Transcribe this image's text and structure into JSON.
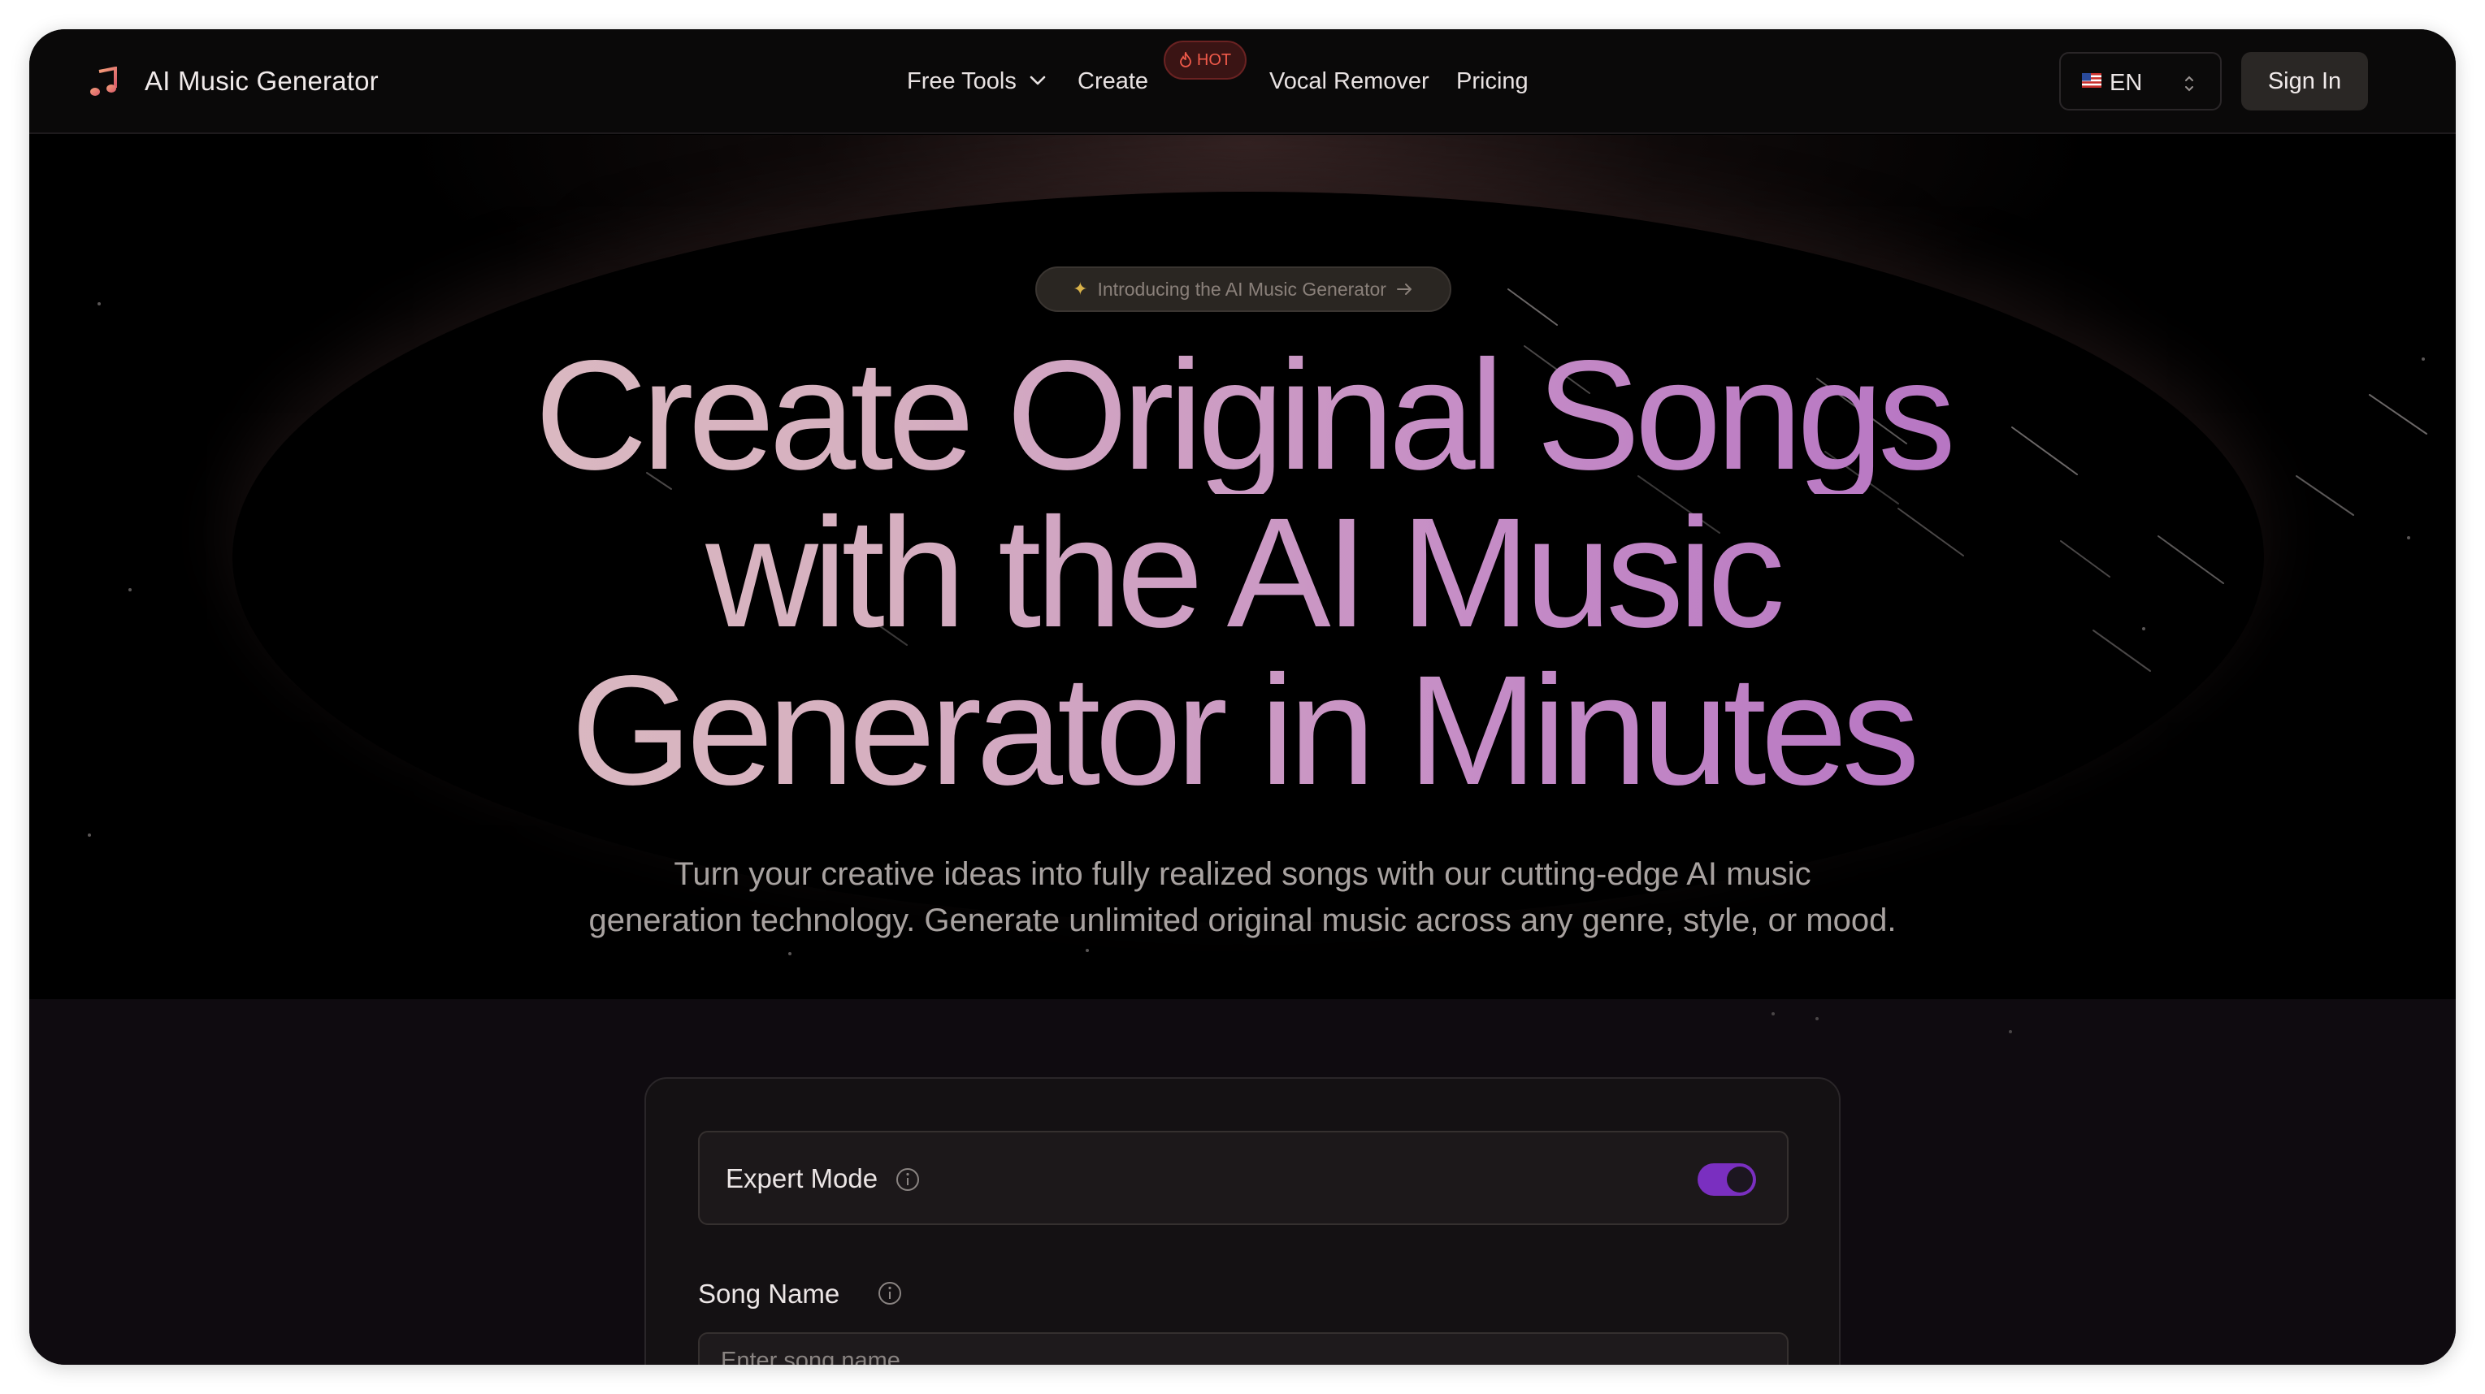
{
  "brand": {
    "name": "AI Music Generator",
    "logo_icon": "music-note-icon"
  },
  "nav": {
    "links": [
      {
        "label": "Free Tools",
        "has_dropdown": true
      },
      {
        "label": "Create",
        "badge": "HOT"
      },
      {
        "label": "Vocal Remover"
      },
      {
        "label": "Pricing"
      }
    ],
    "language": {
      "flag": "us-flag-icon",
      "code": "EN"
    },
    "sign_in_label": "Sign In"
  },
  "hero": {
    "intro_pill": "Introducing the AI Music Generator",
    "headline_lines": [
      "Create Original Songs",
      "with the AI Music",
      "Generator in Minutes"
    ],
    "subtitle_lines": [
      "Turn your creative ideas into fully realized songs with our cutting-edge AI music",
      "generation technology. Generate unlimited original music across any genre, style, or mood."
    ]
  },
  "form": {
    "expert_mode": {
      "label": "Expert Mode",
      "enabled": true
    },
    "song_name": {
      "label": "Song Name",
      "placeholder": "Enter song name",
      "value": ""
    }
  },
  "colors": {
    "background": "#000000",
    "gradient_start": "#e0c4c2",
    "gradient_end": "#a85ec0",
    "toggle_on": "#7a2fc0",
    "hot_badge": "#f05a4a"
  }
}
